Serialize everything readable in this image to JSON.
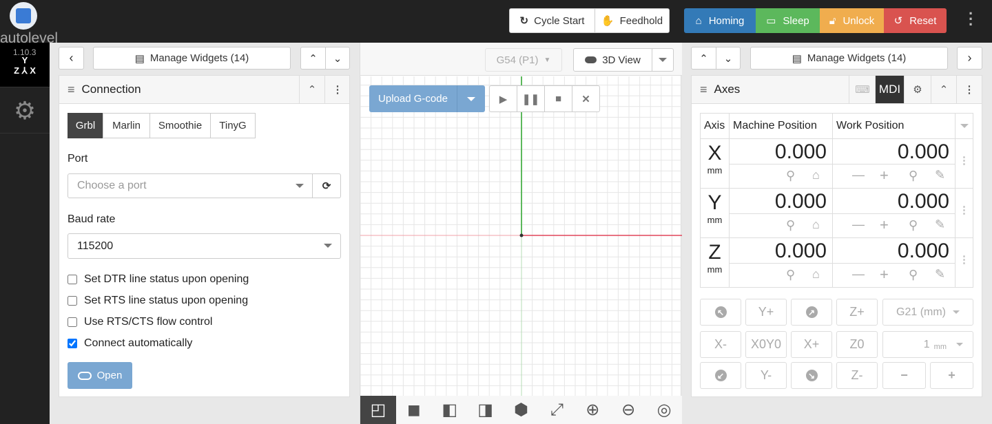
{
  "app": {
    "name": "autolevel",
    "version": "1.10.3"
  },
  "sidebar": {
    "items": [
      {
        "icon": "xyz-axes-icon",
        "selected": true
      },
      {
        "icon": "gears-icon",
        "selected": false
      }
    ]
  },
  "toolbar": {
    "cycle_start": "Cycle Start",
    "feedhold": "Feedhold",
    "homing": "Homing",
    "sleep": "Sleep",
    "unlock": "Unlock",
    "reset": "Reset",
    "colors": {
      "homing": "#337ab7",
      "sleep": "#5cb85c",
      "unlock": "#f0ad4e",
      "reset": "#d9534f"
    }
  },
  "left": {
    "manage_widgets": "Manage Widgets (14)",
    "connection": {
      "title": "Connection",
      "controllers": [
        "Grbl",
        "Marlin",
        "Smoothie",
        "TinyG"
      ],
      "active_controller": "Grbl",
      "port_label": "Port",
      "port_placeholder": "Choose a port",
      "baud_label": "Baud rate",
      "baud_value": "115200",
      "options": [
        {
          "label": "Set DTR line status upon opening",
          "checked": false
        },
        {
          "label": "Set RTS line status upon opening",
          "checked": false
        },
        {
          "label": "Use RTS/CTS flow control",
          "checked": false
        },
        {
          "label": "Connect automatically",
          "checked": true
        }
      ],
      "open_button": "Open"
    }
  },
  "center": {
    "wcs": "G54 (P1)",
    "view_toggle": "3D View",
    "upload": "Upload G-code",
    "view_buttons": [
      "3d-view-icon",
      "top-view-icon",
      "front-view-icon",
      "right-side-view-icon",
      "left-side-view-icon",
      "fit-view-icon",
      "zoom-in-icon",
      "zoom-out-icon",
      "camera-mode-icon"
    ]
  },
  "right": {
    "manage_widgets": "Manage Widgets (14)",
    "axes": {
      "title": "Axes",
      "mdi": "MDI",
      "headers": [
        "Axis",
        "Machine Position",
        "Work Position"
      ],
      "rows": [
        {
          "axis": "X",
          "unit": "mm",
          "machine": "0.000",
          "work": "0.000"
        },
        {
          "axis": "Y",
          "unit": "mm",
          "machine": "0.000",
          "work": "0.000"
        },
        {
          "axis": "Z",
          "unit": "mm",
          "machine": "0.000",
          "work": "0.000"
        }
      ],
      "jog": {
        "yplus": "Y+",
        "xminus": "X-",
        "x0y0": "X0Y0",
        "xplus": "X+",
        "yminus": "Y-",
        "zplus": "Z+",
        "z0": "Z0",
        "zminus": "Z-",
        "units": "G21 (mm)",
        "step": "1",
        "step_unit": "mm"
      }
    }
  }
}
